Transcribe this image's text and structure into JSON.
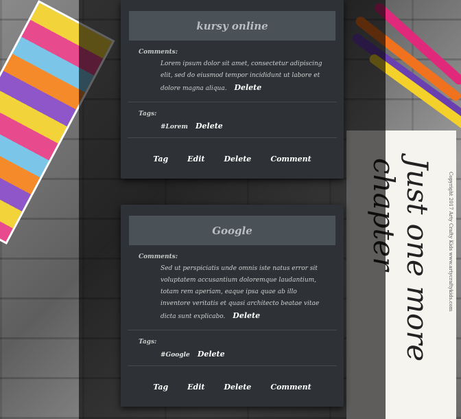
{
  "cards": [
    {
      "title": "kursy online",
      "comments_label": "Comments:",
      "comment_text": "Lorem ipsum dolor sit amet, consectetur adipiscing elit, sed do eiusmod tempor incididunt ut labore et dolore magna aliqua.",
      "comment_delete": "Delete",
      "tags_label": "Tags:",
      "tag": "#Lorem",
      "tag_delete": "Delete",
      "actions": {
        "tag": "Tag",
        "edit": "Edit",
        "delete": "Delete",
        "comment": "Comment"
      }
    },
    {
      "title": "Google",
      "comments_label": "Comments:",
      "comment_text": "Sed ut perspiciatis unde omnis iste natus error sit voluptatem accusantium doloremque laudantium, totam rem aperiam, eaque ipsa quae ab illo inventore veritatis et quasi architecto beatae vitae dicta sunt explicabo.",
      "comment_delete": "Delete",
      "tags_label": "Tags:",
      "tag": "#Google",
      "tag_delete": "Delete",
      "actions": {
        "tag": "Tag",
        "edit": "Edit",
        "delete": "Delete",
        "comment": "Comment"
      }
    }
  ],
  "background": {
    "poster_text": "Just one more chapter",
    "poster_copyright": "Copyright 2017 Arty Crafty Kids www.artycraftykids.com"
  }
}
